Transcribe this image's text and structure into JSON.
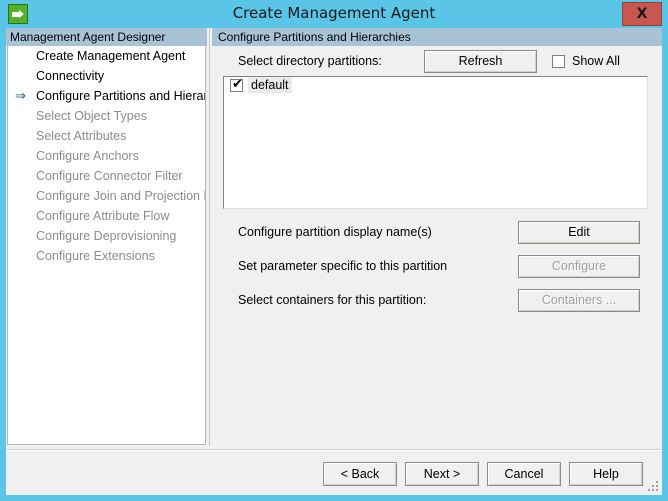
{
  "window": {
    "title": "Create Management Agent",
    "icon": "app-arrow-icon",
    "close_label": "X",
    "titlebar_color": "#5bc5e8",
    "close_color": "#c8584f",
    "header_color": "#a9c3d6"
  },
  "left_pane": {
    "header": "Management Agent Designer",
    "current_marker": "⇒",
    "items": [
      {
        "label": "Create Management Agent",
        "state": "done",
        "current": false
      },
      {
        "label": "Connectivity",
        "state": "done",
        "current": false
      },
      {
        "label": "Configure Partitions and Hierarchies",
        "state": "current",
        "current": true
      },
      {
        "label": "Select Object Types",
        "state": "disabled",
        "current": false
      },
      {
        "label": "Select Attributes",
        "state": "disabled",
        "current": false
      },
      {
        "label": "Configure Anchors",
        "state": "disabled",
        "current": false
      },
      {
        "label": "Configure Connector Filter",
        "state": "disabled",
        "current": false
      },
      {
        "label": "Configure Join and Projection Rules",
        "state": "disabled",
        "current": false
      },
      {
        "label": "Configure Attribute Flow",
        "state": "disabled",
        "current": false
      },
      {
        "label": "Configure Deprovisioning",
        "state": "disabled",
        "current": false
      },
      {
        "label": "Configure Extensions",
        "state": "disabled",
        "current": false
      }
    ]
  },
  "right_pane": {
    "header": "Configure Partitions and Hierarchies",
    "partitions_label": "Select directory partitions:",
    "refresh_button": "Refresh",
    "show_all": {
      "label": "Show All",
      "checked": false
    },
    "partitions": [
      {
        "label": "default",
        "checked": true,
        "selected": true
      }
    ],
    "actions": [
      {
        "label": "Configure partition display name(s)",
        "button": "Edit",
        "enabled": true
      },
      {
        "label": "Set parameter specific to this partition",
        "button": "Configure",
        "enabled": false
      },
      {
        "label": "Select containers for this partition:",
        "button": "Containers ...",
        "enabled": false
      }
    ]
  },
  "bottom_bar": {
    "back": "< Back",
    "next": "Next >",
    "cancel": "Cancel",
    "help": "Help"
  }
}
